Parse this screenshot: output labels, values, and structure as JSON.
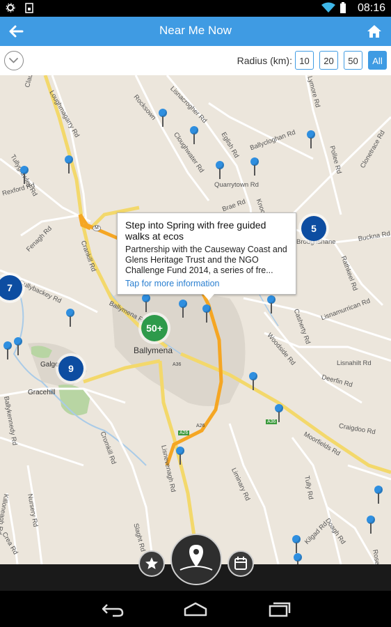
{
  "status_bar": {
    "time": "08:16"
  },
  "app_bar": {
    "title": "Near Me Now"
  },
  "filter_bar": {
    "radius_label": "Radius (km):",
    "radius_options": [
      "10",
      "20",
      "50",
      "All"
    ],
    "selected": "All"
  },
  "map": {
    "town": "Ballymena",
    "road_labels": [
      "Claudytown",
      "Loughmagarry Rd",
      "Rocksown",
      "Lisnacrogher Rd",
      "Cloughwater Rd",
      "Eglish Rd",
      "Ballycloghan Rd",
      "Lymore Rd",
      "Pollee Rd",
      "Clonetrace Rd",
      "Tullygrawley Rd",
      "Rexford Rd",
      "Quarrytown Rd",
      "Brae Rd",
      "Knock Rd",
      "Fenagh Rd",
      "Broughshane",
      "Buckna Rd",
      "Crankill Rd",
      "Ballymena Rd",
      "Rathkeel Rd",
      "Lisnamurrican Rd",
      "Cullybackey Rd",
      "Casherty Rd",
      "Woodside Rd",
      "Lisnahilt Rd",
      "Deerfin Rd",
      "Galgorm",
      "Gracehill",
      "Ballykennedy Rd",
      "Cromkill Rd",
      "Lisnevenagh Rd",
      "Liminary Rd",
      "Craigdoo Rd",
      "Moorfields Rd",
      "Tully Rd",
      "Nursery Rd",
      "Doagh Rd",
      "Killoneagh Rd",
      "Crea Rd",
      "Slaght Rd",
      "Kilgad Rd",
      "Rosel"
    ],
    "route_shields": [
      "A36",
      "A26",
      "A26",
      "A36",
      "M"
    ],
    "clusters": [
      {
        "label": "5",
        "color": "blue"
      },
      {
        "label": "7",
        "color": "blue"
      },
      {
        "label": "9",
        "color": "blue"
      },
      {
        "label": "50+",
        "color": "green"
      }
    ]
  },
  "popup": {
    "title": "Step into Spring with free guided walks at ecos",
    "body": "Partnership with the Causeway Coast and Glens Heritage Trust and the NGO Challenge Fund 2014, a series of fre...",
    "link": "Tap for more information"
  },
  "bottom_actions": {
    "favorites_icon": "star-icon",
    "location_icon": "map-pin-icon",
    "calendar_icon": "calendar-icon"
  },
  "colors": {
    "accent": "#3f9be3",
    "cluster_blue": "#0d4da1",
    "cluster_green": "#2e9a4b",
    "pin": "#2f8fe0",
    "major_road": "#f5a623",
    "secondary_road": "#f3d86b"
  }
}
